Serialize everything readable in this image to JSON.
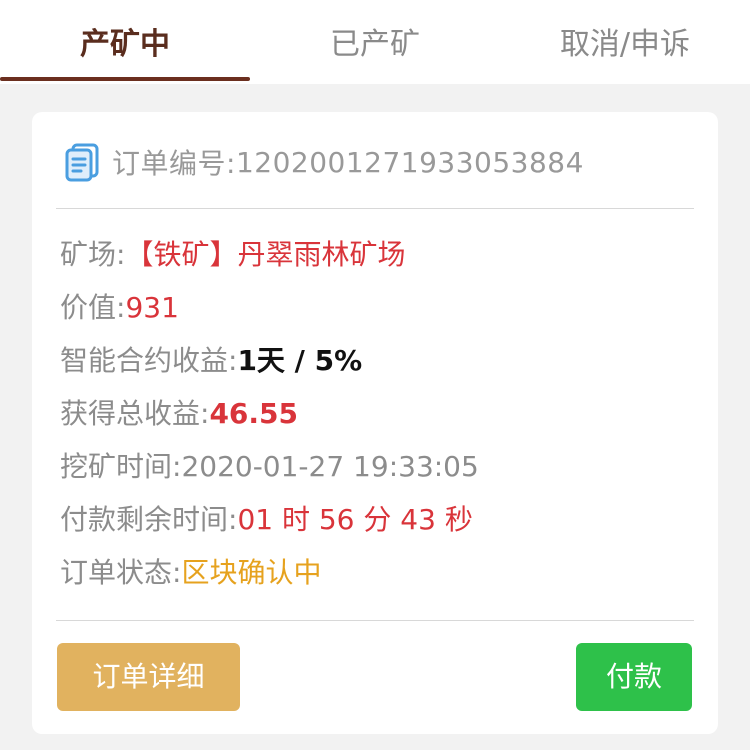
{
  "tabs": [
    {
      "label": "产矿中",
      "active": true
    },
    {
      "label": "已产矿",
      "active": false
    },
    {
      "label": "取消/申诉",
      "active": false
    }
  ],
  "order": {
    "number_label": "订单编号:",
    "number_value": "1202001271933053884",
    "icon": "document-icon"
  },
  "fields": {
    "mine": {
      "label": "矿场:",
      "value": "【铁矿】丹翠雨林矿场"
    },
    "value": {
      "label": "价值:",
      "value": "931"
    },
    "contract_yield": {
      "label": "智能合约收益:",
      "value": "1天 / 5%"
    },
    "total_income": {
      "label": "获得总收益:",
      "value": "46.55"
    },
    "mining_time": {
      "label": "挖矿时间:",
      "value": "2020-01-27 19:33:05"
    },
    "pay_remaining": {
      "label": "付款剩余时间:",
      "value": "01 时 56 分 43 秒"
    },
    "status": {
      "label": "订单状态:",
      "value": "区块确认中"
    }
  },
  "buttons": {
    "detail_label": "订单详细",
    "pay_label": "付款"
  },
  "colors": {
    "active_tab": "#5a2d1e",
    "tab_indicator": "#6b2f1f",
    "red_value": "#d9343a",
    "status_orange": "#e6a21e",
    "detail_button": "#e1b25f",
    "pay_button": "#2ec14a"
  }
}
